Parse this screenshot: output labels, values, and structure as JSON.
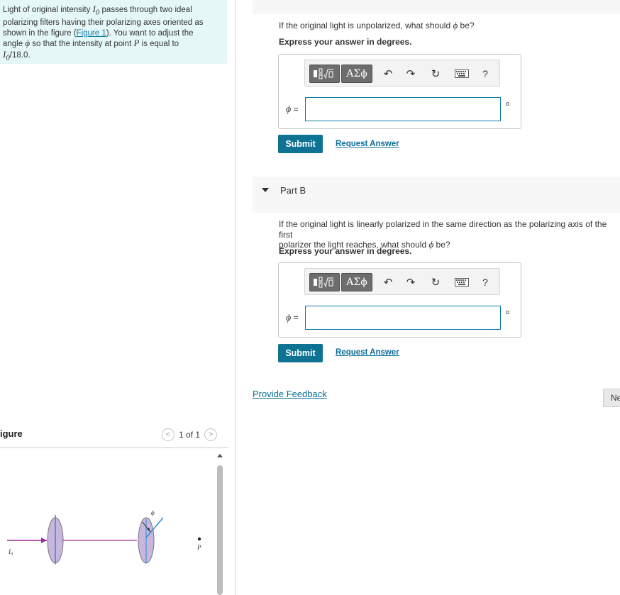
{
  "problem": {
    "line1_pre": "Light of original intensity ",
    "I0": "I",
    "I0_sub": "0",
    "line1_post": " passes through two ideal",
    "line2": "polarizing filters having their polarizing axes oriented as",
    "line3_pre": "shown in the figure (",
    "figure_link": "Figure 1",
    "line3_post": "). You want to adjust the",
    "line4_pre": "angle ",
    "phi": "ϕ",
    "line4_mid": " so that the intensity at point ",
    "P": "P",
    "line4_post": " is equal to",
    "line5_post": "/18.0."
  },
  "figure": {
    "title": "igure",
    "pager": "1 of 1",
    "prev_icon": "<",
    "next_icon": ">",
    "label_I0": "I",
    "label_I0_sub": "0",
    "label_phi": "ϕ",
    "label_P": "P"
  },
  "partA": {
    "question_pre": "If the original light is unpolarized, what should ",
    "phi": "ϕ",
    "question_post": " be?",
    "instruction": "Express your answer in degrees.",
    "answer_label_phi": "ϕ",
    "answer_label_eq": " =",
    "input_value": "",
    "unit": "o",
    "submit": "Submit",
    "request": "Request Answer"
  },
  "partB": {
    "title": "Part B",
    "question_line1": "If the original light is linearly polarized in the same direction as the polarizing axis of the first",
    "question_line2_pre": "polarizer the light reaches, what should ",
    "phi": "ϕ",
    "question_line2_post": " be?",
    "instruction": "Express your answer in degrees.",
    "answer_label_phi": "ϕ",
    "answer_label_eq": " =",
    "input_value": "",
    "unit": "o",
    "submit": "Submit",
    "request": "Request Answer"
  },
  "toolbar": {
    "greek": "ΑΣϕ",
    "undo": "↶",
    "redo": "↷",
    "reset": "↻",
    "help": "?"
  },
  "footer": {
    "feedback": "Provide Feedback",
    "next": "Ne"
  },
  "colors": {
    "problem_bg": "#e6f7f7",
    "accent": "#0e7392",
    "link": "#0b6e9a",
    "polarizer_fill": "#c9b6dc",
    "beam": "#9b2d9b",
    "axis": "#2a8fd6"
  }
}
